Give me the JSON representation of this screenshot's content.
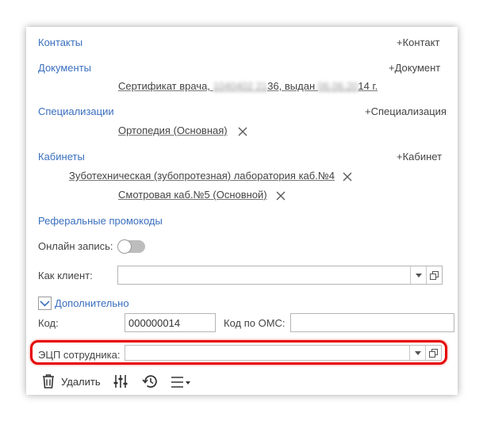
{
  "contacts": {
    "title": "Контакты",
    "add": "+Контакт"
  },
  "documents": {
    "title": "Документы",
    "add": "+Документ",
    "item": {
      "prefix": "Сертификат врача, ",
      "blur1": "1040402 21",
      "mid": "36, выдан ",
      "blur2": "06.06.20",
      "suffix": "14 г."
    }
  },
  "specializations": {
    "title": "Специализации",
    "add": "+Специализация",
    "items": [
      "Ортопедия (Основная)"
    ]
  },
  "cabinets": {
    "title": "Кабинеты",
    "add": "+Кабинет",
    "items": [
      "Зуботехническая (зубопротезная) лаборатория каб.№4",
      "Смотровая каб.№5 (Основной)"
    ]
  },
  "referral": {
    "title": "Реферальные промокоды"
  },
  "online": {
    "label": "Онлайн запись:",
    "enabled": false
  },
  "client": {
    "label": "Как клиент:",
    "value": ""
  },
  "additional": {
    "label": "Дополнительно",
    "expanded": true
  },
  "code": {
    "label": "Код:",
    "value": "000000014"
  },
  "oms": {
    "label": "Код по ОМС:",
    "value": ""
  },
  "ecp": {
    "label": "ЭЦП сотрудника:",
    "value": ""
  },
  "toolbar": {
    "delete_label": "Удалить"
  },
  "colors": {
    "accent": "#3a6fbe",
    "highlight": "#e60000"
  }
}
